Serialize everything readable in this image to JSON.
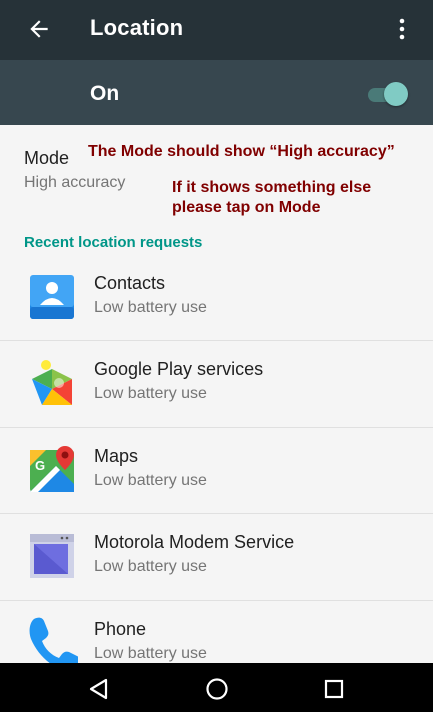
{
  "appbar": {
    "title": "Location",
    "back_icon": "arrow-back-icon",
    "menu_icon": "more-vert-icon"
  },
  "master_switch": {
    "label": "On",
    "state": "on",
    "track_color": "#4a7a78",
    "thumb_color": "#80cbc4"
  },
  "mode": {
    "title": "Mode",
    "value": "High accuracy"
  },
  "annotations": {
    "line1": "The Mode should show “High accuracy”",
    "line2": "If it shows something else",
    "line3": "please tap on Mode",
    "color": "#800000"
  },
  "recent_requests": {
    "header": "Recent location requests",
    "header_color": "#009688",
    "apps": [
      {
        "name": "Contacts",
        "usage": "Low battery use",
        "icon": "contacts-icon"
      },
      {
        "name": "Google Play services",
        "usage": "Low battery use",
        "icon": "google-play-services-icon"
      },
      {
        "name": "Maps",
        "usage": "Low battery use",
        "icon": "maps-icon"
      },
      {
        "name": "Motorola Modem Service",
        "usage": "Low battery use",
        "icon": "motorola-modem-service-icon"
      },
      {
        "name": "Phone",
        "usage": "Low battery use",
        "icon": "phone-icon"
      }
    ]
  },
  "navbar": {
    "back": "nav-back-icon",
    "home": "nav-home-icon",
    "recents": "nav-recents-icon"
  }
}
